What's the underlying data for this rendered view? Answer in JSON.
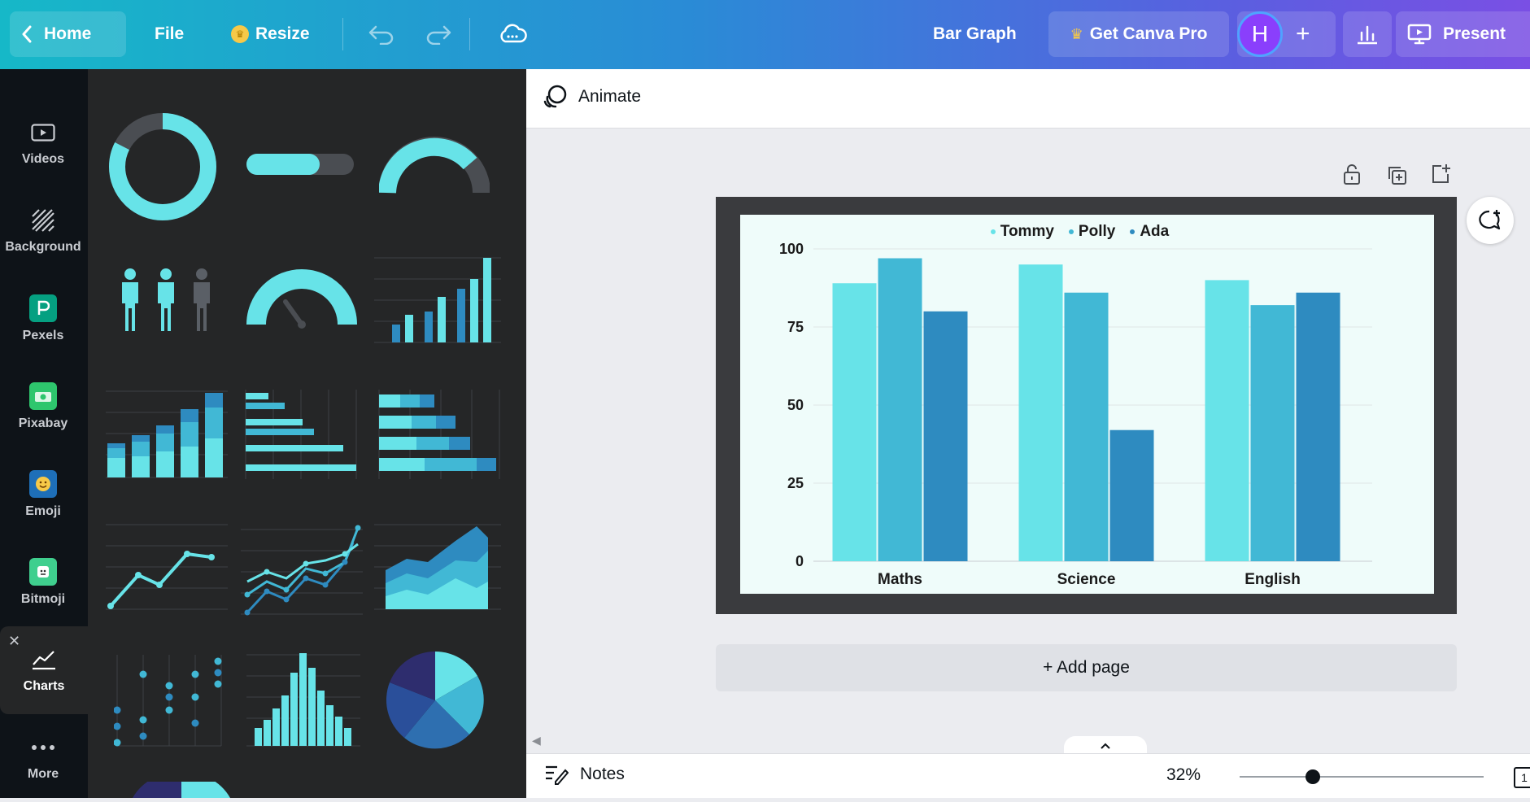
{
  "topbar": {
    "home_label": "Home",
    "file_label": "File",
    "resize_label": "Resize",
    "design_title": "Bar Graph",
    "get_pro_label": "Get Canva Pro",
    "avatar_letter": "H",
    "present_label": "Present"
  },
  "rail": {
    "items": [
      {
        "label": "Videos",
        "icon": "video-icon"
      },
      {
        "label": "Background",
        "icon": "hatch-icon"
      },
      {
        "label": "Pexels",
        "icon": "pexels-icon"
      },
      {
        "label": "Pixabay",
        "icon": "pixabay-icon"
      },
      {
        "label": "Emoji",
        "icon": "emoji-icon"
      },
      {
        "label": "Bitmoji",
        "icon": "bitmoji-icon"
      },
      {
        "label": "Charts",
        "icon": "line-chart-icon"
      },
      {
        "label": "More",
        "icon": "more-dots-icon"
      }
    ]
  },
  "toolbar": {
    "animate_label": "Animate"
  },
  "canvas": {
    "add_page_label": "+ Add page"
  },
  "bottom": {
    "notes_label": "Notes",
    "zoom_label": "32%",
    "zoom_fraction": 0.3,
    "page_indicator": "1"
  },
  "colors": {
    "accent_light": "#67e3e8",
    "accent_mid": "#41b8d5",
    "accent_dark": "#2e8bc0",
    "panel_bg": "#252627",
    "rail_bg": "#0e1318"
  },
  "chart_data": {
    "type": "bar",
    "categories": [
      "Maths",
      "Science",
      "English"
    ],
    "series": [
      {
        "name": "Tommy",
        "values": [
          89,
          95,
          90
        ],
        "color": "#67e3e8"
      },
      {
        "name": "Polly",
        "values": [
          97,
          86,
          82
        ],
        "color": "#41b8d5"
      },
      {
        "name": "Ada",
        "values": [
          80,
          42,
          86
        ],
        "color": "#2e8bc0"
      }
    ],
    "yticks": [
      0,
      25,
      50,
      75,
      100
    ],
    "ylim": [
      0,
      100
    ],
    "legend": "top-center",
    "grid": true
  }
}
